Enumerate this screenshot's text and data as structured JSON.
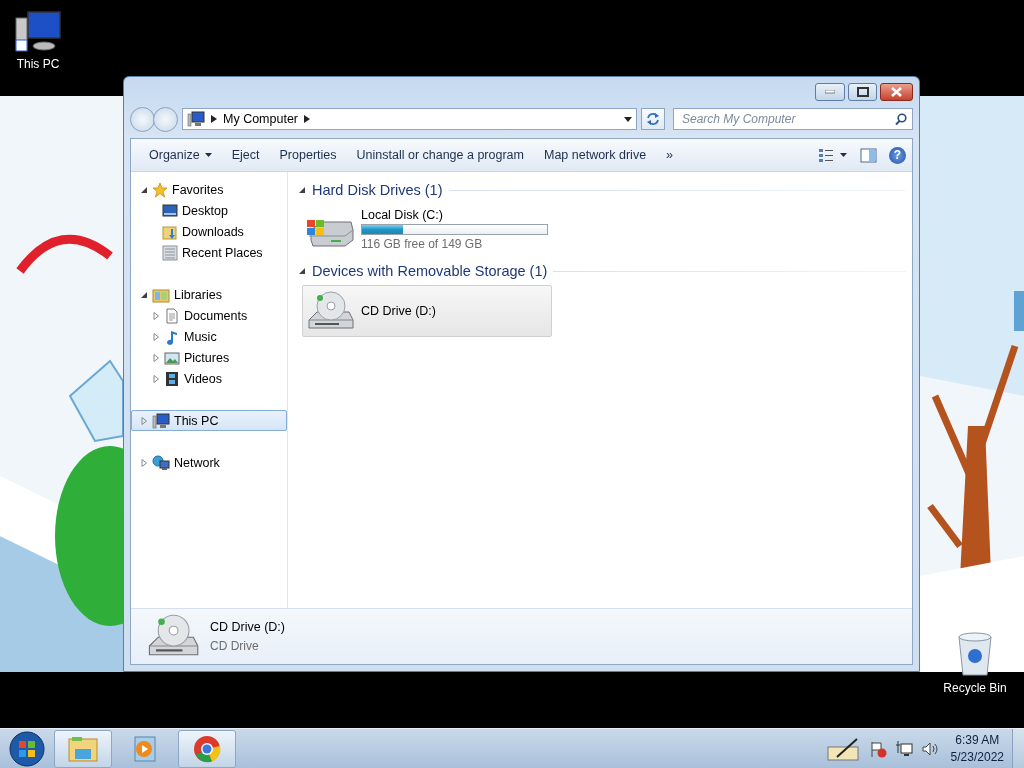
{
  "desktop_icons": [
    {
      "kind": "computer",
      "label": "This PC"
    },
    {
      "kind": "bin",
      "label": "Recycle Bin"
    }
  ],
  "window": {
    "address": {
      "path": [
        "My Computer"
      ]
    },
    "search": {
      "placeholder": "Search My Computer"
    },
    "toolbar": [
      {
        "kind": "menu",
        "label": "Organize"
      },
      {
        "kind": "button",
        "label": "Eject"
      },
      {
        "kind": "button",
        "label": "Properties"
      },
      {
        "kind": "button",
        "label": "Uninstall or change a program"
      },
      {
        "kind": "button",
        "label": "Map network drive"
      },
      {
        "kind": "button",
        "label": "»"
      }
    ],
    "help_label": "?",
    "nav": [
      {
        "label": "Favorites",
        "expanded": true,
        "selected": false,
        "children": [
          {
            "label": "Desktop",
            "selected": false
          },
          {
            "label": "Downloads",
            "selected": false
          },
          {
            "label": "Recent Places",
            "selected": false
          }
        ]
      },
      {
        "label": "Libraries",
        "expanded": true,
        "selected": false,
        "children": [
          {
            "label": "Documents",
            "expanded": false,
            "selected": false
          },
          {
            "label": "Music",
            "expanded": false,
            "selected": false
          },
          {
            "label": "Pictures",
            "expanded": false,
            "selected": false
          },
          {
            "label": "Videos",
            "expanded": false,
            "selected": false
          }
        ]
      },
      {
        "label": "This PC",
        "expanded": false,
        "selected": true
      },
      {
        "label": "Network",
        "expanded": false,
        "selected": false
      }
    ],
    "sections": [
      {
        "title": "Hard Disk Drives (1)",
        "expanded": true,
        "items": [
          {
            "kind": "disk",
            "name": "Local Disk (C:)",
            "level": 0.22,
            "free": "116 GB free of 149 GB",
            "selected": false
          }
        ]
      },
      {
        "title": "Devices with Removable Storage (1)",
        "expanded": true,
        "items": [
          {
            "kind": "cd",
            "name": "CD Drive (D:)",
            "selected": true
          }
        ]
      }
    ],
    "details": {
      "name": "CD Drive (D:)",
      "type": "CD Drive"
    }
  },
  "taskbar": {
    "apps": [
      {
        "kind": "folder",
        "running": true
      },
      {
        "kind": "player",
        "running": false
      },
      {
        "kind": "browser",
        "running": true
      }
    ],
    "time": "6:39 AM",
    "date": "5/23/2022"
  }
}
